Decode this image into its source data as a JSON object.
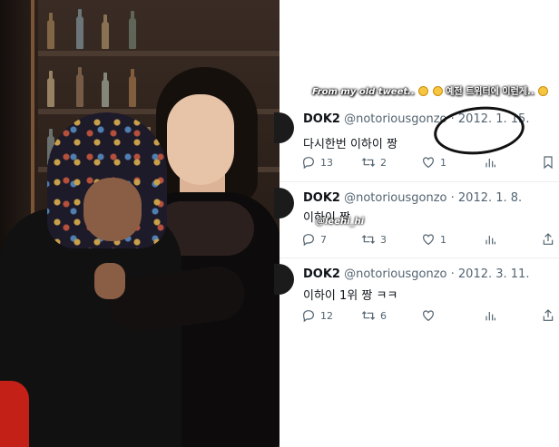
{
  "caption": {
    "english": "From my old tweet..",
    "korean": "예전 트위터에 이런게..",
    "emoji": [
      "grinning-sweat-emoji",
      "laughing-emoji",
      "shocked-emoji"
    ]
  },
  "tweets": [
    {
      "display_name": "DOK2",
      "handle": "@notoriousgonzo",
      "date": "· 2012. 1. 15.",
      "text": "다시한번 이하이 짱",
      "reply_count": "13",
      "retweet_count": "2",
      "like_count": "1"
    },
    {
      "display_name": "DOK2",
      "handle": "@notoriousgonzo",
      "date": "· 2012. 1. 8.",
      "text": "이하이 짱",
      "mention": "@leehi_hi",
      "reply_count": "7",
      "retweet_count": "3",
      "like_count": "1"
    },
    {
      "display_name": "DOK2",
      "handle": "@notoriousgonzo",
      "date": "· 2012. 3. 11.",
      "text": "이하이 1위 짱 ㅋㅋ",
      "reply_count": "12",
      "retweet_count": "6",
      "like_count": ""
    }
  ],
  "colors": {
    "text_primary": "#0f1419",
    "text_secondary": "#536471",
    "divider": "#eeeeee",
    "circle_mark": "#111111"
  }
}
